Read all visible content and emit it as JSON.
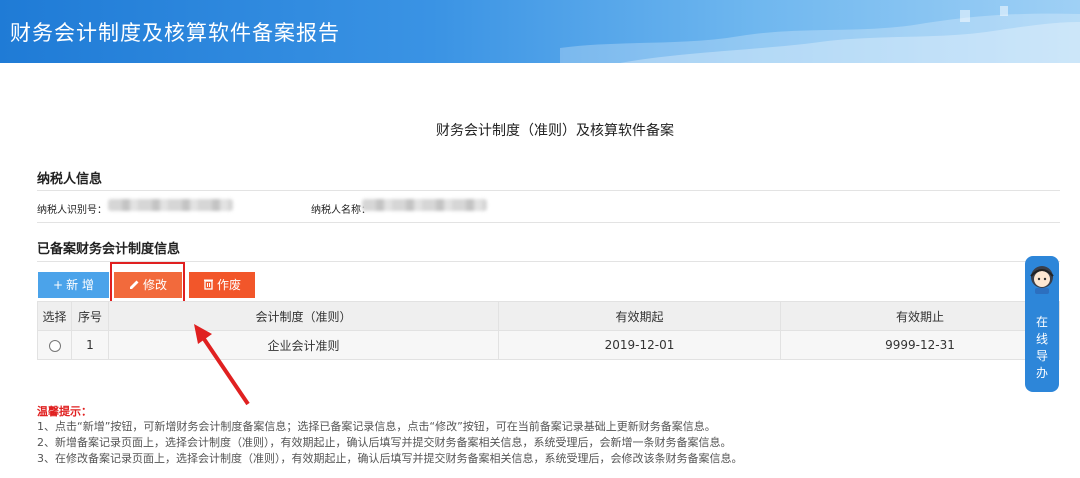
{
  "header": {
    "title": "财务会计制度及核算软件备案报告"
  },
  "page_title": "财务会计制度（准则）及核算软件备案",
  "taxpayer": {
    "section_title": "纳税人信息",
    "id_label": "纳税人识别号：",
    "name_label": "纳税人名称："
  },
  "filed": {
    "section_title": "已备案财务会计制度信息",
    "buttons": {
      "add": "新 增",
      "edit": "修改",
      "void": "作废"
    },
    "columns": [
      "选择",
      "序号",
      "会计制度（准则）",
      "有效期起",
      "有效期止"
    ],
    "rows": [
      {
        "index": "1",
        "standard": "企业会计准则",
        "start": "2019-12-01",
        "end": "9999-12-31"
      }
    ]
  },
  "tips": {
    "title": "温馨提示：",
    "items": [
      "1、点击“新增”按钮，可新增财务会计制度备案信息；选择已备案记录信息，点击“修改”按钮，可在当前备案记录基础上更新财务备案信息。",
      "2、新增备案记录页面上，选择会计制度（准则），有效期起止，确认后填写并提交财务备案相关信息，系统受理后，会新增一条财务备案信息。",
      "3、在修改备案记录页面上，选择会计制度（准则），有效期起止，确认后填写并提交财务备案相关信息，系统受理后，会修改该条财务备案信息。"
    ]
  },
  "side_widget": {
    "label": "在线导办"
  },
  "colors": {
    "accent": "#2d86d9",
    "edit": "#f26a3c",
    "void": "#f2562a",
    "add": "#4ba3ea",
    "highlight": "#e02020"
  }
}
